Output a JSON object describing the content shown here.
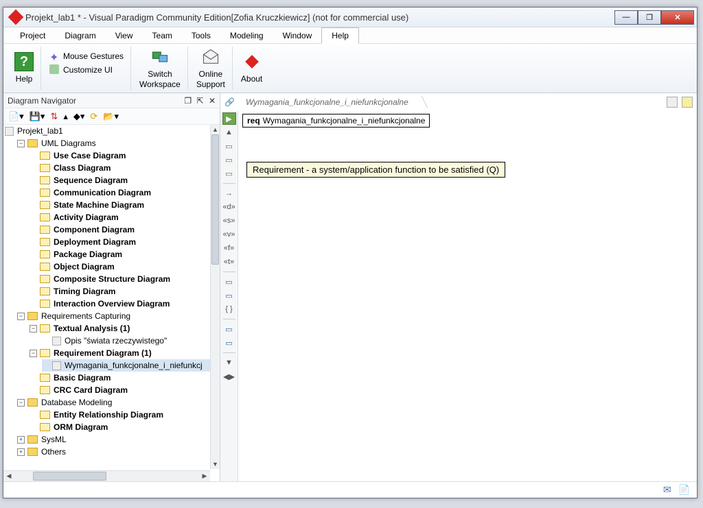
{
  "titlebar": {
    "title": "Projekt_lab1 * - Visual Paradigm Community Edition[Zofia Kruczkiewicz] (not for commercial use)"
  },
  "menubar": {
    "items": [
      "Project",
      "Diagram",
      "View",
      "Team",
      "Tools",
      "Modeling",
      "Window",
      "Help"
    ],
    "active": "Help"
  },
  "toolbar": {
    "help": "Help",
    "mouse_gestures": "Mouse Gestures",
    "customize_ui": "Customize UI",
    "switch_workspace": "Switch\nWorkspace",
    "online_support": "Online\nSupport",
    "about": "About"
  },
  "navigator": {
    "title": "Diagram Navigator",
    "root": "Projekt_lab1",
    "groups": {
      "uml": "UML Diagrams",
      "req": "Requirements Capturing",
      "db": "Database Modeling",
      "sysml": "SysML",
      "others": "Others"
    },
    "uml_items": [
      "Use Case Diagram",
      "Class Diagram",
      "Sequence Diagram",
      "Communication Diagram",
      "State Machine Diagram",
      "Activity Diagram",
      "Component Diagram",
      "Deployment Diagram",
      "Package Diagram",
      "Object Diagram",
      "Composite Structure Diagram",
      "Timing Diagram",
      "Interaction Overview Diagram"
    ],
    "req_items": {
      "textual": "Textual Analysis (1)",
      "textual_child": "Opis \"świata rzeczywistego\"",
      "reqdiag": "Requirement Diagram (1)",
      "reqdiag_child": "Wymagania_funkcjonalne_i_niefunkcj",
      "basic": "Basic Diagram",
      "crc": "CRC Card Diagram"
    },
    "db_items": [
      "Entity Relationship Diagram",
      "ORM Diagram"
    ]
  },
  "breadcrumb": {
    "name": "Wymagania_funkcjonalne_i_niefunkcjonalne"
  },
  "canvas": {
    "req_prefix": "req",
    "req_name": "Wymagania_funkcjonalne_i_niefunkcjonalne",
    "tooltip": "Requirement - a system/application function to be satisfied (Q)"
  }
}
